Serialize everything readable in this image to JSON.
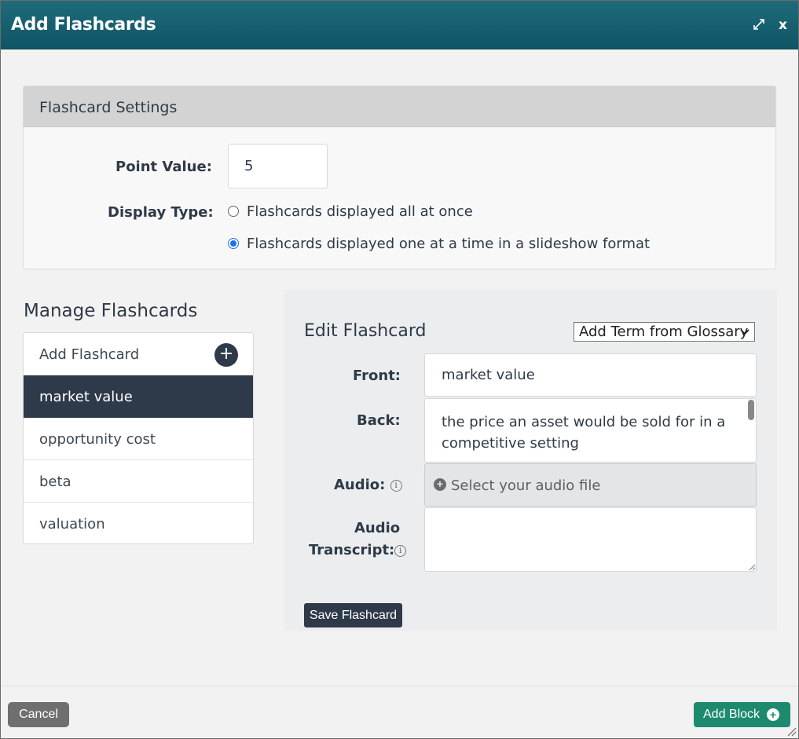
{
  "dialog": {
    "title": "Add Flashcards",
    "close_label": "x"
  },
  "settings": {
    "header": "Flashcard Settings",
    "point_value_label": "Point Value:",
    "point_value": "5",
    "display_type_label": "Display Type:",
    "options": [
      {
        "label": "Flashcards displayed all at once",
        "selected": false
      },
      {
        "label": "Flashcards displayed one at a time in a slideshow format",
        "selected": true
      }
    ]
  },
  "manage": {
    "title": "Manage Flashcards",
    "add_label": "Add Flashcard",
    "add_icon_glyph": "+",
    "items": [
      {
        "label": "market value",
        "active": true
      },
      {
        "label": "opportunity cost",
        "active": false
      },
      {
        "label": "beta",
        "active": false
      },
      {
        "label": "valuation",
        "active": false
      }
    ]
  },
  "edit": {
    "title": "Edit Flashcard",
    "glossary_label": "Add Term from Glossary",
    "front_label": "Front:",
    "front_value": "market value",
    "back_label": "Back:",
    "back_value": "the price an asset would be sold for in a competitive setting",
    "audio_label": "Audio:",
    "audio_placeholder": "Select your audio file",
    "transcript_label_line1": "Audio",
    "transcript_label_line2": "Transcript:",
    "transcript_value": "",
    "info_glyph": "i",
    "save_label": "Save Flashcard"
  },
  "footer": {
    "cancel_label": "Cancel",
    "add_block_label": "Add Block"
  },
  "colors": {
    "titlebar": "#0f5565",
    "dark": "#2e3a4a",
    "add_block": "#1d8a6f",
    "cancel": "#6f6f6f",
    "radio_selected": "#1a73e8"
  }
}
